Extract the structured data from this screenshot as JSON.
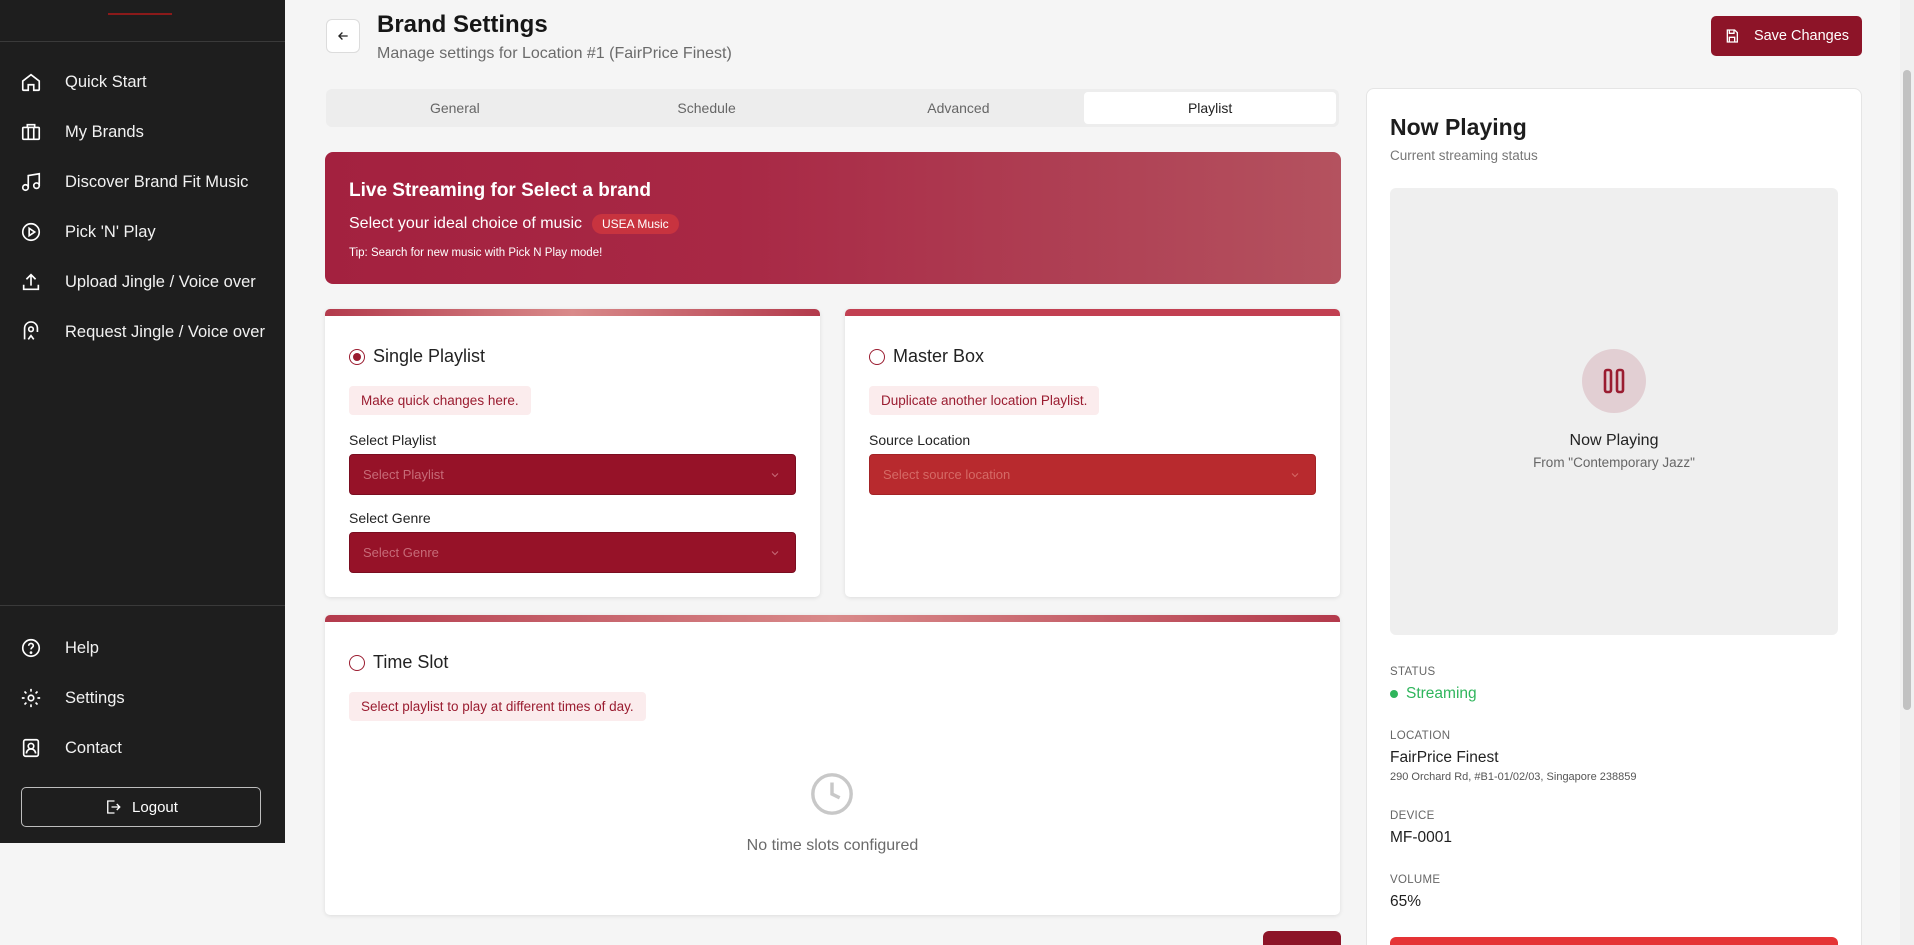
{
  "header": {
    "title": "Brand Settings",
    "subtitle": "Manage settings for Location #1 (FairPrice Finest)",
    "save_label": "Save Changes"
  },
  "sidebar": {
    "items": [
      {
        "label": "Quick Start",
        "icon": "home-icon"
      },
      {
        "label": "My Brands",
        "icon": "brands-icon"
      },
      {
        "label": "Discover Brand Fit Music",
        "icon": "music-note-icon"
      },
      {
        "label": "Pick 'N' Play",
        "icon": "play-circle-icon"
      },
      {
        "label": "Upload Jingle / Voice over",
        "icon": "upload-icon"
      },
      {
        "label": "Request Jingle / Voice over",
        "icon": "request-icon"
      }
    ],
    "bottom_items": [
      {
        "label": "Help",
        "icon": "help-icon"
      },
      {
        "label": "Settings",
        "icon": "gear-icon"
      },
      {
        "label": "Contact",
        "icon": "contact-icon"
      }
    ],
    "logout_label": "Logout"
  },
  "tabs": [
    "General",
    "Schedule",
    "Advanced",
    "Playlist"
  ],
  "active_tab": "Playlist",
  "banner": {
    "title": "Live Streaming for Select a brand",
    "text": "Select your ideal choice of music",
    "badge": "USEA Music",
    "tip": "Tip: Search for new music with Pick N Play mode!"
  },
  "single_playlist": {
    "label": "Single Playlist",
    "selected": true,
    "hint": "Make quick changes here.",
    "playlist_label": "Select Playlist",
    "playlist_placeholder": "Select Playlist",
    "genre_label": "Select Genre",
    "genre_placeholder": "Select Genre"
  },
  "master_box": {
    "label": "Master Box",
    "selected": false,
    "hint": "Duplicate another location Playlist.",
    "source_label": "Source Location",
    "source_placeholder": "Select source location"
  },
  "time_slot": {
    "label": "Time Slot",
    "selected": false,
    "hint": "Select playlist to play at different times of day.",
    "empty_text": "No time slots configured"
  },
  "now_playing": {
    "title": "Now Playing",
    "subtitle": "Current streaming status",
    "player_title": "Now Playing",
    "player_from": "From \"Contemporary Jazz\"",
    "status_key": "STATUS",
    "status_value": "Streaming",
    "location_key": "LOCATION",
    "location_name": "FairPrice Finest",
    "location_address": "290 Orchard Rd, #B1-01/02/03, Singapore 238859",
    "device_key": "DEVICE",
    "device_value": "MF-0001",
    "volume_key": "VOLUME",
    "volume_value": "65%"
  },
  "colors": {
    "brand": "#8d1428",
    "sidebar_bg": "#1e1e1e",
    "status_green": "#2fb55c"
  }
}
